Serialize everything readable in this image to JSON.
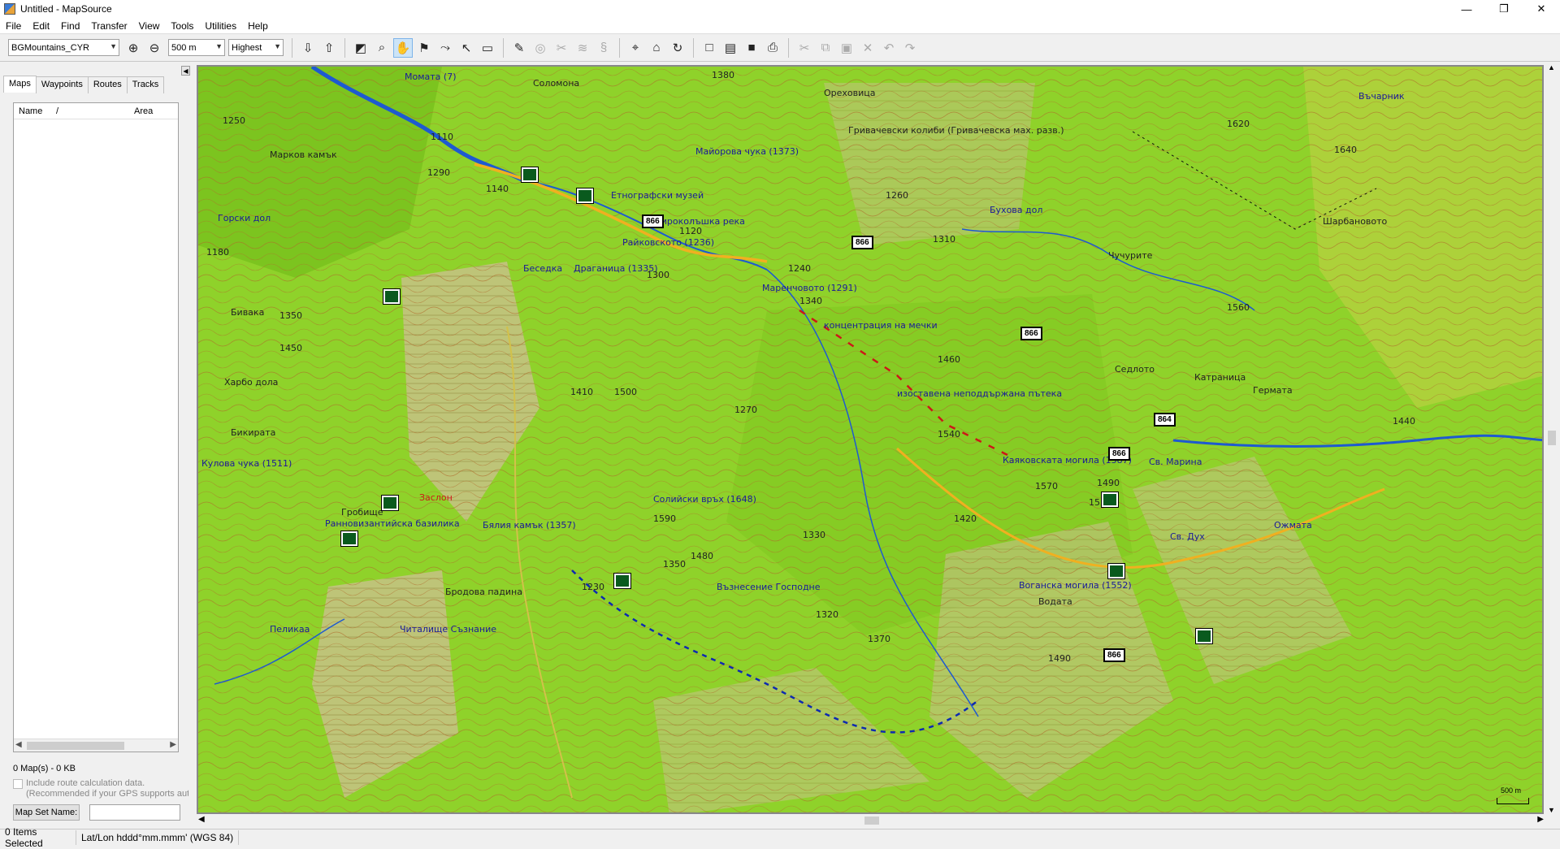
{
  "window": {
    "title": "Untitled - MapSource",
    "minimize": "—",
    "maximize": "❐",
    "close": "✕"
  },
  "menu": [
    "File",
    "Edit",
    "Find",
    "Transfer",
    "View",
    "Tools",
    "Utilities",
    "Help"
  ],
  "toolbar": {
    "map_product": "BGMountains_CYR",
    "zoom_scale": "500 m",
    "detail": "Highest"
  },
  "sidebar": {
    "tabs": [
      "Maps",
      "Waypoints",
      "Routes",
      "Tracks"
    ],
    "columns": [
      "Name",
      "/",
      "Area"
    ],
    "map_count": "0 Map(s) - 0 KB",
    "include_route": "Include route calculation data.",
    "include_note": "(Recommended if your GPS supports auto",
    "map_set_button": "Map Set Name:"
  },
  "map": {
    "labels": [
      "Момата (7)",
      "Соломона",
      "Марков камък",
      "Горски дол",
      "Бивака",
      "Харбо дола",
      "Бикирата",
      "Кулова чука (1511)",
      "Гробище",
      "Ранновизантийска базилика",
      "Заслон",
      "Бялия камък (1357)",
      "Бродова падина",
      "Читалище Съзнание",
      "Пеликаа",
      "Беседка",
      "Драганица (1335)",
      "Райковското (1236)",
      "Етнографски музей",
      "Широколъшка река",
      "Майорова чука (1373)",
      "Гривачевски колиби (Гривачевска мах. разв.)",
      "Маренчовото (1291)",
      "концентрация на мечки",
      "изоставена неподдържана пътека",
      "Каяковската могила (1587)",
      "Св. Марина",
      "Воганска могила (1552)",
      "Възнесение Господне",
      "Солийски връх (1648)",
      "Ореховица",
      "Бухова дол",
      "Чучурите",
      "Въчарник",
      "Шарбановото",
      "Седлото",
      "Катраница",
      "Гермата",
      "Водата",
      "Св. Дух",
      "Ожмата"
    ],
    "elevations": [
      "1110",
      "1290",
      "1250",
      "1180",
      "1350",
      "1450",
      "1140",
      "1120",
      "1300",
      "1410",
      "1500",
      "1270",
      "1240",
      "1340",
      "1310",
      "1460",
      "1540",
      "1570",
      "1490",
      "1420",
      "1590",
      "1480",
      "1330",
      "1350",
      "1230",
      "1320",
      "1370",
      "1380",
      "1260",
      "1530",
      "1620",
      "1640",
      "1560",
      "1440",
      "1490"
    ],
    "road_shields": [
      "866",
      "866",
      "866",
      "866",
      "864",
      "866"
    ],
    "scale_text": "500 m"
  },
  "status": {
    "selection": "0 Items Selected",
    "coord_format": "Lat/Lon hddd°mm.mmm' (WGS 84)"
  },
  "colors": {
    "forest": "#8fd22a",
    "forest_dark": "#6fb21a",
    "rock": "#c9b88a",
    "contour": "#b06a2a",
    "river": "#1e5ad0",
    "road": "#f0b020"
  }
}
